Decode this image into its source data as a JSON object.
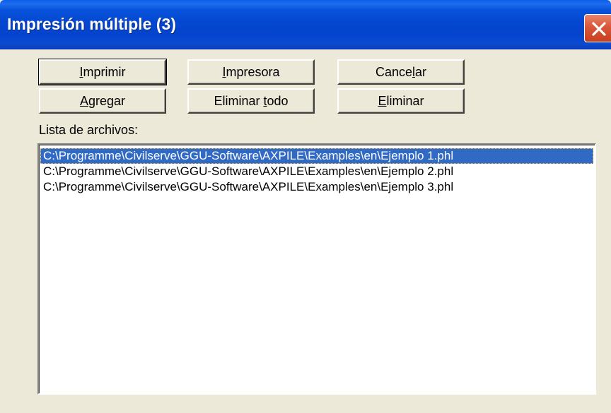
{
  "window": {
    "title": "Impresión múltiple (3)",
    "accent_color": "#0A4BD2",
    "close_icon": "close-icon"
  },
  "buttons": {
    "print": {
      "pre": "",
      "accel": "I",
      "post": "mprimir"
    },
    "printer": {
      "pre": "",
      "accel": "I",
      "post": "mpresora"
    },
    "cancel": {
      "pre": "Cance",
      "accel": "l",
      "post": "ar"
    },
    "add": {
      "pre": "",
      "accel": "A",
      "post": "gregar"
    },
    "delete_all": {
      "pre": "Eliminar ",
      "accel": "t",
      "post": "odo"
    },
    "delete": {
      "pre": "",
      "accel": "E",
      "post": "liminar"
    }
  },
  "file_list": {
    "label": "Lista de archivos:",
    "items": [
      "C:\\Programme\\Civilserve\\GGU-Software\\AXPILE\\Examples\\en\\Ejemplo 1.phl",
      "C:\\Programme\\Civilserve\\GGU-Software\\AXPILE\\Examples\\en\\Ejemplo 2.phl",
      "C:\\Programme\\Civilserve\\GGU-Software\\AXPILE\\Examples\\en\\Ejemplo 3.phl"
    ],
    "selected_index": 0,
    "selection_color": "#316AC5"
  }
}
